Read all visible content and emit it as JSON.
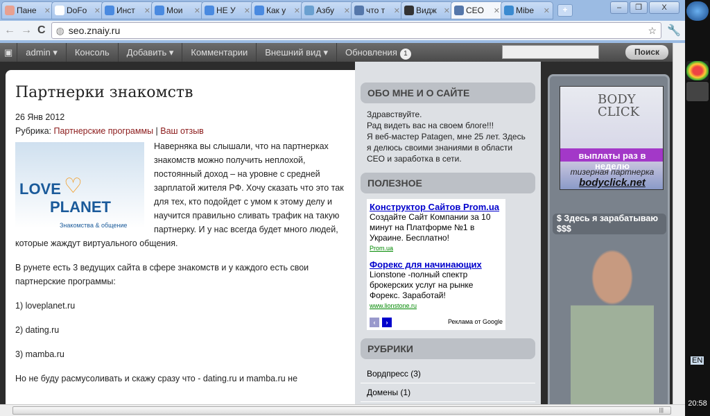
{
  "browser": {
    "tabs": [
      {
        "label": "Пане",
        "color": "#e8a090"
      },
      {
        "label": "DoFo",
        "color": "#ffffff"
      },
      {
        "label": "Инст",
        "color": "#4a8ae0"
      },
      {
        "label": "Мои",
        "color": "#4a8ae0"
      },
      {
        "label": "НЕ У",
        "color": "#4a8ae0"
      },
      {
        "label": "Как у",
        "color": "#4a8ae0"
      },
      {
        "label": "Азбу",
        "color": "#6aa0d0"
      },
      {
        "label": "что т",
        "color": "#5577aa"
      },
      {
        "label": "Видж",
        "color": "#333333"
      },
      {
        "label": "CEO",
        "color": "#5577aa",
        "active": true
      },
      {
        "label": "Mibe",
        "color": "#3a8ad0"
      }
    ],
    "close_symbol": "✕",
    "url": "seo.znaiy.ru",
    "window_controls": [
      "–",
      "❐",
      "X"
    ]
  },
  "adminbar": {
    "items": [
      "admin ▾",
      "Консоль",
      "Добавить ▾",
      "Комментарии",
      "Внешний вид ▾",
      "Обновления"
    ],
    "updates_count": "1",
    "search_button": "Поиск"
  },
  "post": {
    "title": "Партнерки знакомств",
    "date": "26 Янв 2012",
    "rubric_label": "Рубрика: ",
    "rubric_link": "Партнерские программы",
    "separator": " | ",
    "reply_link": "Ваш отзыв",
    "logo": {
      "line1": "LOVE",
      "line2": "PLANET",
      "tagline": "Знакомства & общение"
    },
    "intro": "Наверняка вы слышали, что на партнерках знакомств можно получить неплохой,  постоянный доход – на уровне с средней зарплатой жителя РФ. Хочу сказать что это так для тех, кто подойдет с умом к этому делу и научится правильно сливать трафик на такую партнерку. И у нас всегда будет  много людей, которые жаждут виртуального общения.",
    "p1": "В рунете есть 3 ведущих сайта в сфере знакомств и у каждого есть свои  партнерские программы:",
    "list": [
      "1) loveplanet.ru",
      "2) dating.ru",
      "3) mamba.ru"
    ],
    "p2": "Но не буду расмусоливать и скажу сразу что - dating.ru и mamba.ru не"
  },
  "sidebar": {
    "about_title": "ОБО МНЕ И О САЙТЕ",
    "about_lines": [
      "Здравствуйте.",
      "Рад видеть вас на своем блоге!!!",
      "Я веб-мастер Patagen, мне 25 лет. Здесь я делюсь своими знаниями в области СЕО и заработка в сети."
    ],
    "useful_title": "ПОЛЕЗНОЕ",
    "ads": [
      {
        "title": "Конструктор Сайтов Prom.ua",
        "text": "Создайте Сайт Компании за 10 минут на Платформе №1 в Украине. Бесплатно!",
        "url": "Prom.ua"
      },
      {
        "title": "Форекс для начинающих",
        "text": "Lionstone -полный спектр брокерских услуг на рынке Форекс. Заработай!",
        "url": "www.lionstone.ru"
      }
    ],
    "ads_by": "Реклама от Google",
    "rubrics_title": "РУБРИКИ",
    "rubrics": [
      "Вордпресс (3)",
      "Домены (1)"
    ]
  },
  "right": {
    "banner": {
      "brand": "BODY CLICK",
      "slogan": "выплаты раз в неделю",
      "sub": "тизерная партнерка",
      "site": "bodyclick.net"
    },
    "earn_title": "$ Здесь я зарабатываю $$$"
  },
  "taskbar": {
    "lang": "EN",
    "time": "20:58"
  }
}
